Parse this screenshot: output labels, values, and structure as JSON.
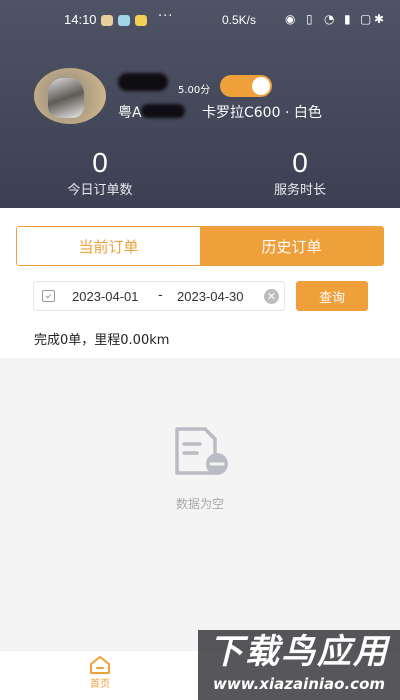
{
  "status_bar": {
    "time": "14:10",
    "more": "···",
    "net_speed": "0.5K/s"
  },
  "driver": {
    "score": "5.00分",
    "plate_prefix": "粤A",
    "car": "卡罗拉C600 · 白色",
    "online_toggle": "on"
  },
  "stats": {
    "today_orders_value": "0",
    "today_orders_label": "今日订单数",
    "service_time_value": "0",
    "service_time_label": "服务时长"
  },
  "tabs": {
    "current": "当前订单",
    "history": "历史订单",
    "selected": "history"
  },
  "filter": {
    "start_date": "2023-04-01",
    "separator": "-",
    "end_date": "2023-04-30",
    "query_label": "查询"
  },
  "summary": "完成0单，里程0.00km",
  "empty": {
    "text": "数据为空"
  },
  "bottom_nav": {
    "home_label": "首页"
  },
  "watermark": {
    "title": "下载鸟应用",
    "url": "www.xiazainiao.com"
  },
  "colors": {
    "accent": "#f0a03a",
    "header": "#474b5d"
  }
}
